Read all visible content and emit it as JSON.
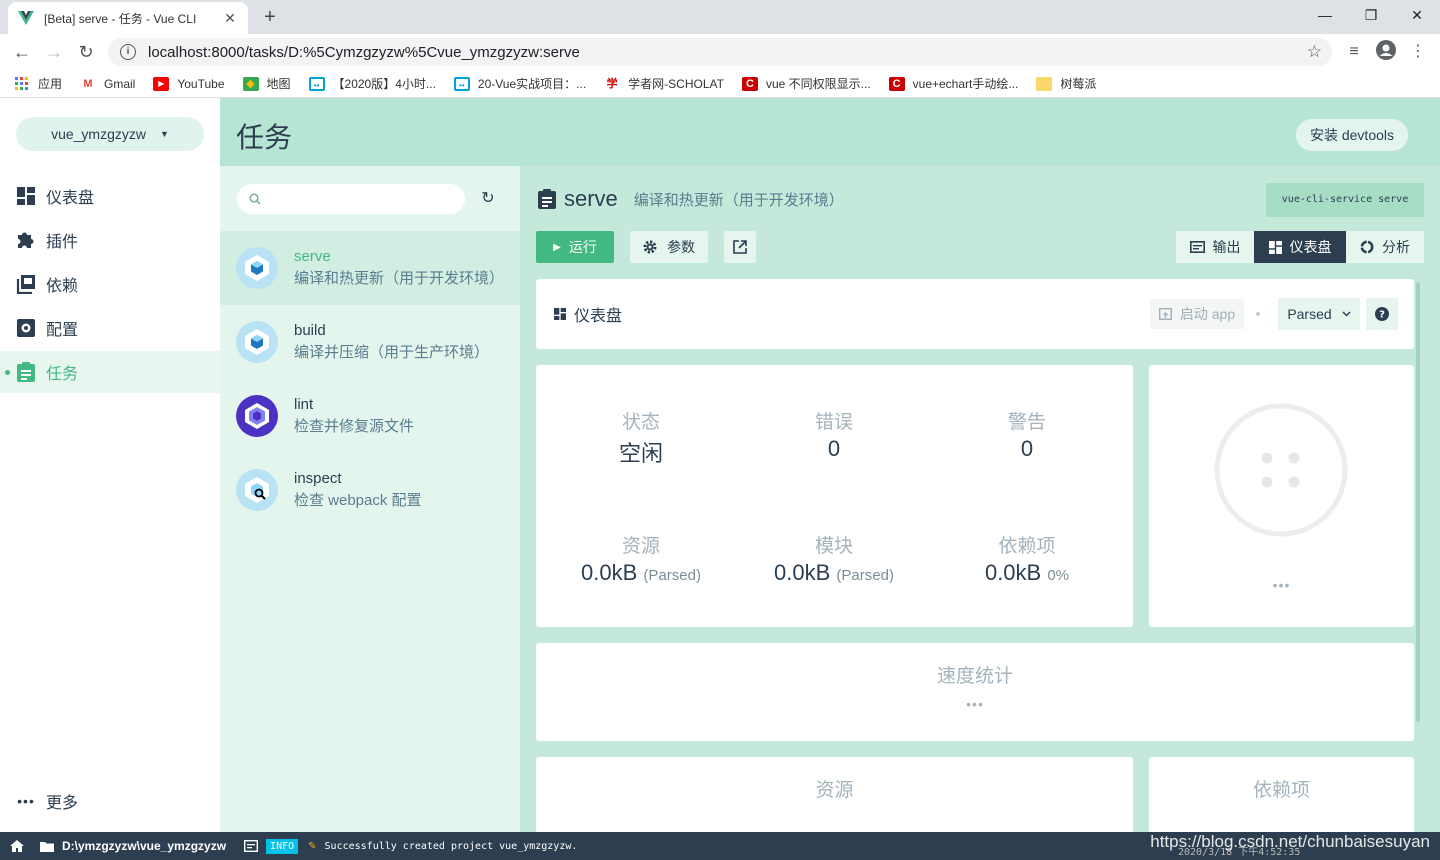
{
  "browser": {
    "tab_title": "[Beta] serve - 任务 - Vue CLI",
    "tab_close": "✕",
    "new_tab": "+",
    "url": "localhost:8000/tasks/D:%5Cymzgzyzw%5Cvue_ymzgzyzw:serve",
    "bookmarks": [
      {
        "label": "应用",
        "icon": "apps-icon"
      },
      {
        "label": "Gmail",
        "icon": "gmail-icon"
      },
      {
        "label": "YouTube",
        "icon": "youtube-icon"
      },
      {
        "label": "地图",
        "icon": "maps-icon"
      },
      {
        "label": "【2020版】4小时...",
        "icon": "bilibili-icon"
      },
      {
        "label": "20-Vue实战项目：...",
        "icon": "bilibili-icon"
      },
      {
        "label": "学者网-SCHOLAT",
        "icon": "scholat-icon"
      },
      {
        "label": "vue 不同权限显示...",
        "icon": "csdn-icon"
      },
      {
        "label": "vue+echart手动绘...",
        "icon": "csdn-icon"
      },
      {
        "label": "树莓派",
        "icon": "folder-icon"
      }
    ]
  },
  "sidebar": {
    "project": "vue_ymzgzyzw",
    "items": [
      {
        "label": "仪表盘",
        "icon": "dashboard-icon"
      },
      {
        "label": "插件",
        "icon": "puzzle-icon"
      },
      {
        "label": "依赖",
        "icon": "library-icon"
      },
      {
        "label": "配置",
        "icon": "settings-icon"
      },
      {
        "label": "任务",
        "icon": "clipboard-icon",
        "active": true
      }
    ],
    "more": "更多"
  },
  "header": {
    "title": "任务",
    "devtools_button": "安装 devtools"
  },
  "tasks": [
    {
      "name": "serve",
      "desc": "编译和热更新（用于开发环境）",
      "active": true
    },
    {
      "name": "build",
      "desc": "编译并压缩（用于生产环境）"
    },
    {
      "name": "lint",
      "desc": "检查并修复源文件"
    },
    {
      "name": "inspect",
      "desc": "检查 webpack 配置"
    }
  ],
  "task_detail": {
    "name": "serve",
    "desc": "编译和热更新（用于开发环境）",
    "command": "vue-cli-service serve",
    "run_label": "运行",
    "params_label": "参数",
    "views": [
      {
        "label": "输出"
      },
      {
        "label": "仪表盘",
        "active": true
      },
      {
        "label": "分析"
      }
    ]
  },
  "dashboard": {
    "title": "仪表盘",
    "start_app": "启动 app",
    "mode": "Parsed",
    "stats_top": [
      {
        "label": "状态",
        "value": "空闲"
      },
      {
        "label": "错误",
        "value": "0"
      },
      {
        "label": "警告",
        "value": "0"
      }
    ],
    "stats_bottom": [
      {
        "label": "资源",
        "value": "0.0kB",
        "unit": "(Parsed)"
      },
      {
        "label": "模块",
        "value": "0.0kB",
        "unit": "(Parsed)"
      },
      {
        "label": "依赖项",
        "value": "0.0kB",
        "unit": "0%"
      }
    ],
    "gauge_ellipsis": "•••",
    "speed_title": "速度统计",
    "speed_ellipsis": "•••",
    "assets_title": "资源",
    "deps_title": "依赖项"
  },
  "statusbar": {
    "path": "D:\\ymzgzyzw\\vue_ymzgzyzw",
    "badge": "INFO",
    "message": "Successfully created project vue_ymzgzyzw.",
    "timestamp": "2020/3/18 下午4:52:35"
  },
  "watermark": "https://blog.csdn.net/chunbaisesuyan",
  "colors": {
    "accent": "#42b983",
    "header": "#b7e5d3",
    "content": "#c4e9db",
    "statusbar": "#2c3e50"
  }
}
